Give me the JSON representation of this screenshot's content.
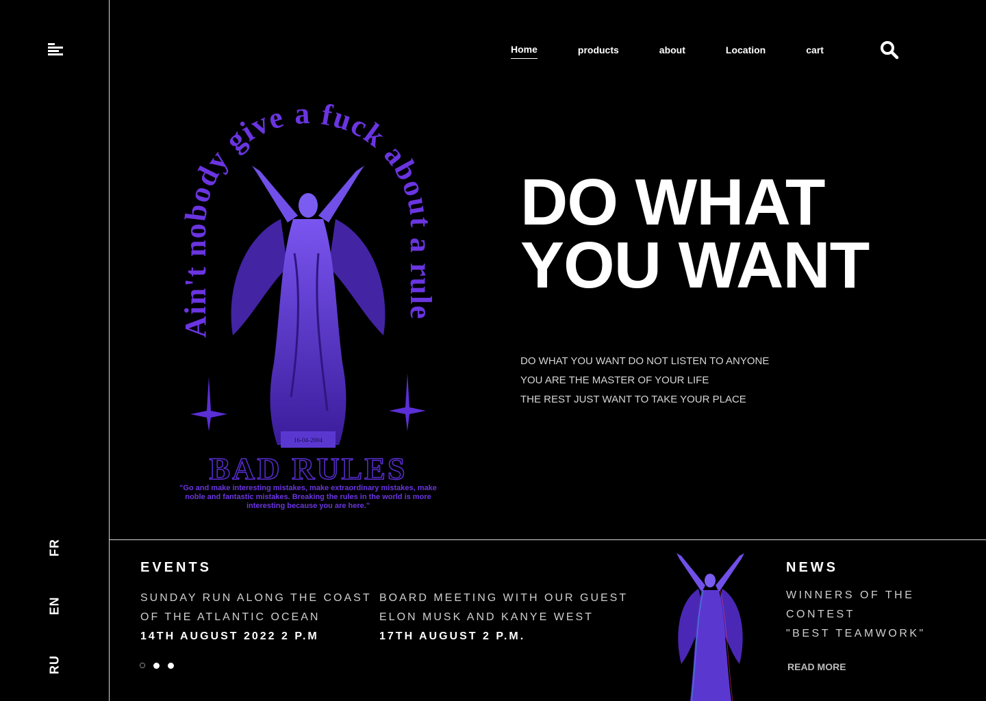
{
  "sidebar": {
    "menu_icon": "hamburger-icon",
    "languages": [
      "FR",
      "EN",
      "RU"
    ]
  },
  "nav": {
    "items": [
      "Home",
      "products",
      "about",
      "Location",
      "cart"
    ],
    "active": "Home",
    "search_icon": "search-icon"
  },
  "art": {
    "arch_text": "Ain't nobody give a fuck about a rule",
    "date_plaque": "16-04-2004",
    "logo_text": "BAD RULES",
    "quote": "\"Go and make interesting mistakes, make extraordinary mistakes, make noble and fantastic mistakes. Breaking the rules in the world is more interesting because you are here.\""
  },
  "hero": {
    "title_line1": "DO WHAT",
    "title_line2": "YOU WANT",
    "sub_line1": "DO WHAT YOU WANT DO NOT LISTEN TO ANYONE",
    "sub_line2": "YOU ARE THE MASTER OF YOUR LIFE",
    "sub_line3": "THE REST JUST WANT TO TAKE YOUR PLACE"
  },
  "events": {
    "title": "EVENTS",
    "items": [
      {
        "line1": "SUNDAY RUN ALONG THE COAST",
        "line2": "OF THE ATLANTIC OCEAN",
        "date": "14TH AUGUST 2022 2 P.M"
      },
      {
        "line1": "BOARD MEETING WITH OUR GUEST",
        "line2": "ELON MUSK AND KANYE WEST",
        "date": "17TH AUGUST 2 P.M."
      }
    ]
  },
  "news": {
    "title": "NEWS",
    "line1": "WINNERS OF THE",
    "line2": "CONTEST",
    "line3": "\"BEST TEAMWORK\"",
    "read_more": "READ MORE"
  },
  "colors": {
    "background": "#000000",
    "accent_purple": "#5b2fd6",
    "text": "#ffffff"
  }
}
